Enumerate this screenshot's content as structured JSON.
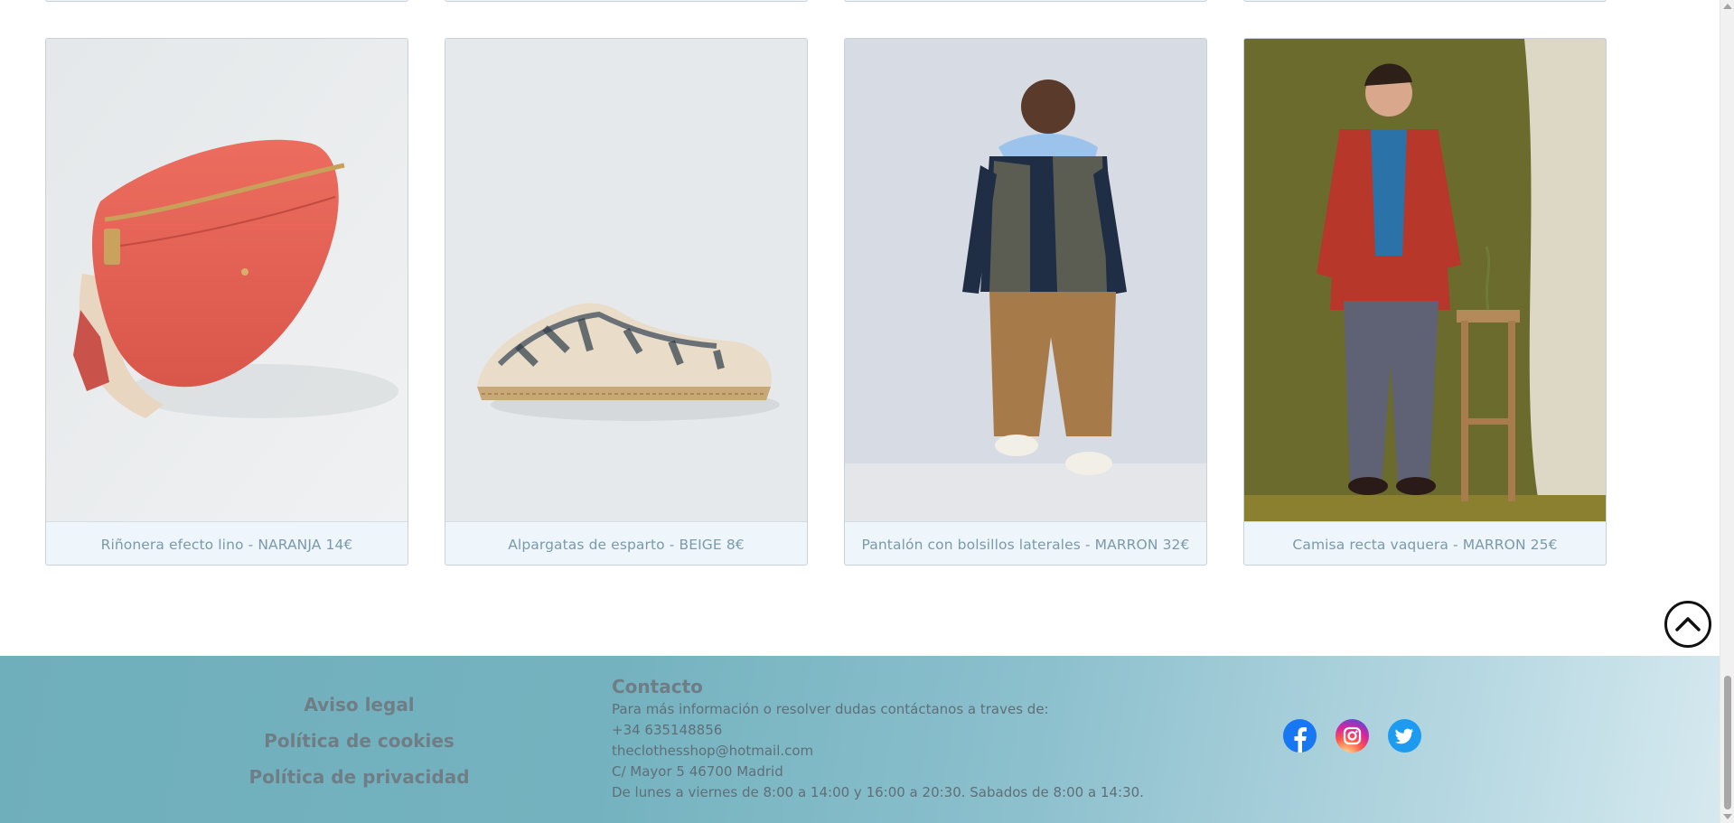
{
  "products": [
    {
      "caption": "Riñonera efecto lino - NARANJA 14€",
      "icon": "fanny-pack-image"
    },
    {
      "caption": "Alpargatas de esparto - BEIGE 8€",
      "icon": "espadrille-image"
    },
    {
      "caption": "Pantalón con bolsillos laterales - MARRON 32€",
      "icon": "cargo-pants-image"
    },
    {
      "caption": "Camisa recta vaquera - MARRON 25€",
      "icon": "shirt-image"
    }
  ],
  "back_to_top": {
    "icon": "chevron-up-icon"
  },
  "footer": {
    "legal": {
      "aviso": "Aviso legal",
      "cookies": "Política de cookies",
      "privacidad": "Política de privacidad"
    },
    "contact": {
      "title": "Contacto",
      "intro": "Para más información o resolver dudas contáctanos a traves de:",
      "phone": "+34 635148856",
      "email": "theclothesshop@hotmail.com",
      "address": "C/ Mayor 5 46700 Madrid",
      "hours": "De lunes a viernes de 8:00 a 14:00 y 16:00 a 20:30. Sabados de 8:00 a 14:30."
    },
    "social": [
      "facebook-icon",
      "instagram-icon",
      "twitter-icon"
    ]
  },
  "colors": {
    "caption_text": "#7a9aaa",
    "card_bg": "#eef6fc",
    "footer_gradient_start": "#6fafbb",
    "footer_gradient_end": "#d6e9ef",
    "facebook": "#1877f2",
    "twitter": "#1d9bf0"
  }
}
